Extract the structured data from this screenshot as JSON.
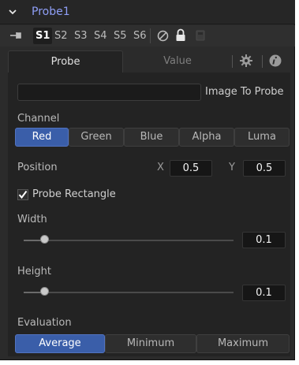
{
  "header": {
    "tool_name": "Probe1"
  },
  "version_slots": {
    "items": [
      "S1",
      "S2",
      "S3",
      "S4",
      "S5",
      "S6"
    ],
    "active": "S1"
  },
  "tabs": {
    "probe": "Probe",
    "value": "Value"
  },
  "image_to_probe": {
    "label": "Image To Probe",
    "value": ""
  },
  "channel": {
    "label": "Channel",
    "options": [
      "Red",
      "Green",
      "Blue",
      "Alpha",
      "Luma"
    ],
    "selected": "Red"
  },
  "position": {
    "label": "Position",
    "x_label": "X",
    "x_value": "0.5",
    "y_label": "Y",
    "y_value": "0.5"
  },
  "probe_rectangle": {
    "label": "Probe Rectangle",
    "checked": true
  },
  "width": {
    "label": "Width",
    "value": "0.1",
    "fraction": 0.1
  },
  "height": {
    "label": "Height",
    "value": "0.1",
    "fraction": 0.1
  },
  "evaluation": {
    "label": "Evaluation",
    "options": [
      "Average",
      "Minimum",
      "Maximum"
    ],
    "selected": "Average"
  },
  "colors": {
    "accent": "#3a5ea9",
    "title": "#8f9ff7",
    "panel_bg": "#232323"
  },
  "icons": {
    "title_toggle": "chevron-down-icon",
    "pin": "pin-icon",
    "pass_through": "pass-through-icon",
    "lock": "lock-icon",
    "cache": "cache-icon",
    "settings": "gear-icon",
    "info": "info-icon",
    "check": "checkmark-icon"
  }
}
